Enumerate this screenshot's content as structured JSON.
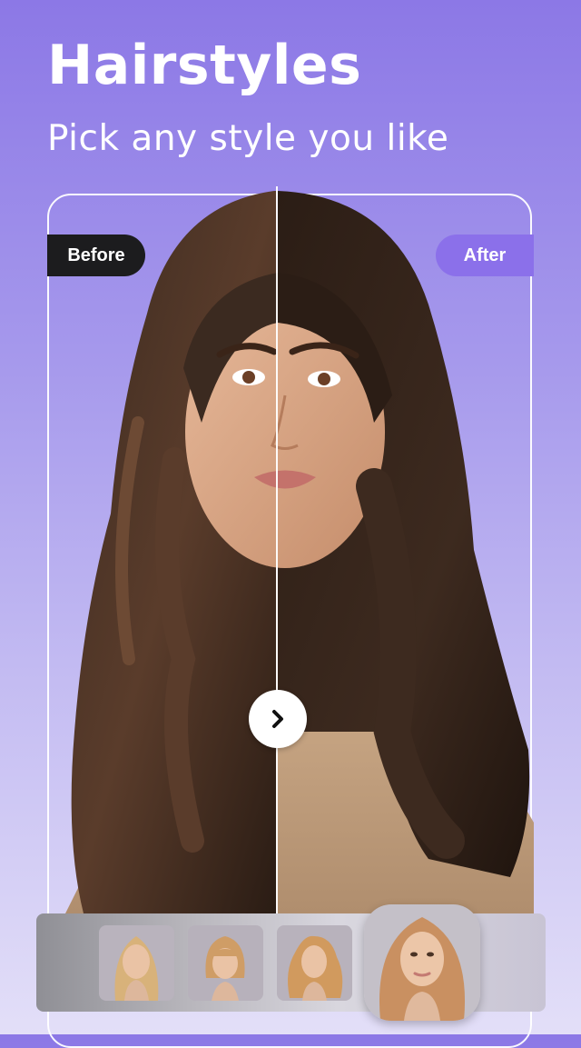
{
  "header": {
    "title": "Hairstyles",
    "subtitle": "Pick any style you like"
  },
  "compare": {
    "before_label": "Before",
    "after_label": "After",
    "slider_icon": "chevron-right-icon"
  },
  "styles": {
    "items": [
      {
        "name": "long-straight-blonde"
      },
      {
        "name": "bob-bangs-blonde"
      },
      {
        "name": "wavy-blonde"
      },
      {
        "name": "long-layered-blonde",
        "selected": true
      }
    ]
  },
  "colors": {
    "accent": "#8b70ea",
    "badge_dark": "#1c1c1e",
    "hair_dark": "#2e1f17"
  }
}
